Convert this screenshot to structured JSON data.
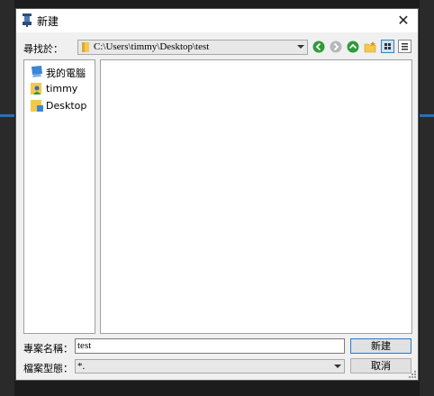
{
  "dialog": {
    "title": "新建",
    "close_glyph": "✕"
  },
  "toolbar": {
    "look_in_label": "尋找於：",
    "current_path": "C:\\Users\\timmy\\Desktop\\test",
    "icons": [
      "back-icon",
      "forward-icon",
      "up-folder-icon",
      "new-folder-icon",
      "list-view-icon",
      "details-view-icon"
    ]
  },
  "places": [
    {
      "label": "我的電腦",
      "icon": "computer-icon"
    },
    {
      "label": "timmy",
      "icon": "user-icon"
    },
    {
      "label": "Desktop",
      "icon": "desktop-folder-icon"
    }
  ],
  "file_name": {
    "label": "專案名稱：",
    "value": "test"
  },
  "file_type": {
    "label": "檔案型態：",
    "value": "*."
  },
  "buttons": {
    "ok": "新建",
    "cancel": "取消"
  },
  "colors": {
    "accent": "#2b79c6",
    "nav_green": "#2e9b3a"
  }
}
